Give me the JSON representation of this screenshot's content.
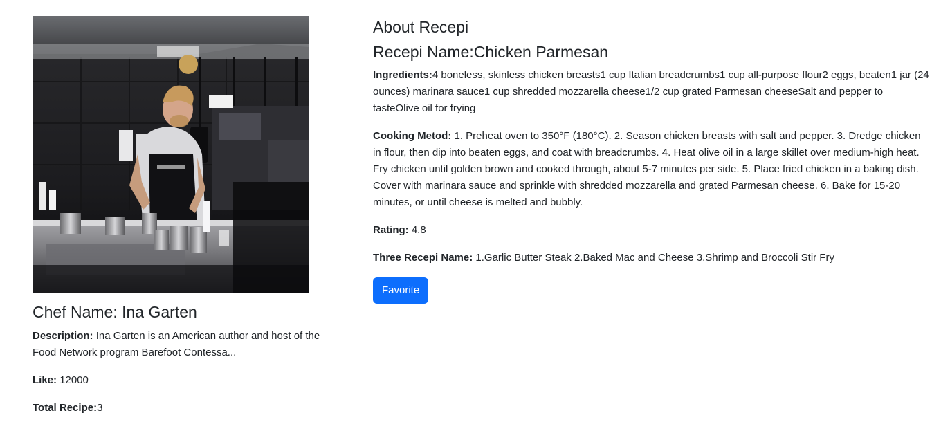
{
  "chef": {
    "name_label": "Chef Name:",
    "name": "Ina Garten",
    "photo_icon": "chef-in-kitchen-photo",
    "description_label": "Description:",
    "description": "Ina Garten is an American author and host of the Food Network program Barefoot Contessa...",
    "likes_label": "Like:",
    "likes": "12000",
    "total_recipe_label": "Total Recipe:",
    "total_recipe": "3"
  },
  "recipe": {
    "about_title": "About Recepi",
    "name_label": "Recepi Name:",
    "name": "Chicken Parmesan",
    "ingredients_label": "Ingredients:",
    "ingredients": "4 boneless, skinless chicken breasts1 cup Italian breadcrumbs1 cup all-purpose flour2 eggs, beaten1 jar (24 ounces) marinara sauce1 cup shredded mozzarella cheese1/2 cup grated Parmesan cheeseSalt and pepper to tasteOlive oil for frying",
    "method_label": "Cooking Metod:",
    "method": "1. Preheat oven to 350°F (180°C). 2. Season chicken breasts with salt and pepper. 3. Dredge chicken in flour, then dip into beaten eggs, and coat with breadcrumbs. 4. Heat olive oil in a large skillet over medium-high heat. Fry chicken until golden brown and cooked through, about 5-7 minutes per side. 5. Place fried chicken in a baking dish. Cover with marinara sauce and sprinkle with shredded mozzarella and grated Parmesan cheese. 6. Bake for 15-20 minutes, or until cheese is melted and bubbly.",
    "rating_label": "Rating:",
    "rating": "4.8",
    "three_label": "Three Recepi Name:",
    "three": "1.Garlic Butter Steak 2.Baked Mac and Cheese 3.Shrimp and Broccoli Stir Fry",
    "favorite_label": "Favorite"
  },
  "colors": {
    "primary_button": "#0d6efd",
    "text": "#212529"
  }
}
